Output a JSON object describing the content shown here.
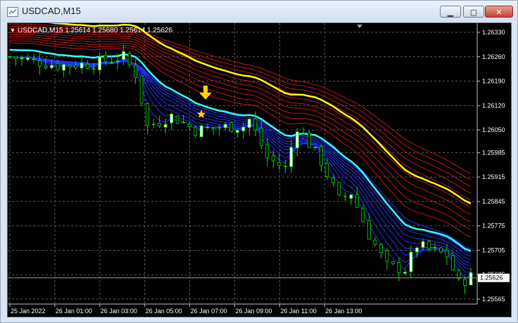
{
  "window": {
    "title": "USDCAD,M15",
    "icon": "chart-window-icon",
    "controls": [
      "minimize-icon",
      "maximize-icon",
      "close-icon"
    ]
  },
  "chart_data": {
    "type": "candlestick",
    "symbol_info": "USDCAD,M15  1.25614 1.25680 1.25614 1.25626",
    "symbol_triangle": "▼",
    "y_ticks": [
      "1.26330",
      "1.26260",
      "1.26190",
      "1.26120",
      "1.26050",
      "1.25985",
      "1.25915",
      "1.25845",
      "1.25775",
      "1.25705",
      "1.25635",
      "1.25565"
    ],
    "ylim": [
      1.25565,
      1.2633
    ],
    "current_price": "1.25626",
    "current_price_value": 1.25626,
    "x_ticks": [
      "25 Jan 2022",
      "26 Jan 01:00",
      "26 Jan 03:00",
      "26 Jan 05:00",
      "26 Jan 07:00",
      "26 Jan 09:00",
      "26 Jan 11:00",
      "26 Jan 13:00"
    ],
    "grid": true,
    "colors": {
      "background": "#000000",
      "grid": "#5a5a5a",
      "bull_candle": "#ffffff",
      "bear_candle": "#000000",
      "wick": "#00e000",
      "yellow_ma": "#ffff00",
      "cyan_ma": "#33ffff",
      "red_ribbon": "#c01818",
      "blue_ribbon": "#2233ff",
      "signal_arrow": "#ffd700"
    },
    "signals": [
      {
        "type": "down-arrow-icon",
        "bar": 52,
        "price": 1.26145
      },
      {
        "type": "star-icon",
        "bar": 51,
        "price": 1.26095
      }
    ]
  }
}
